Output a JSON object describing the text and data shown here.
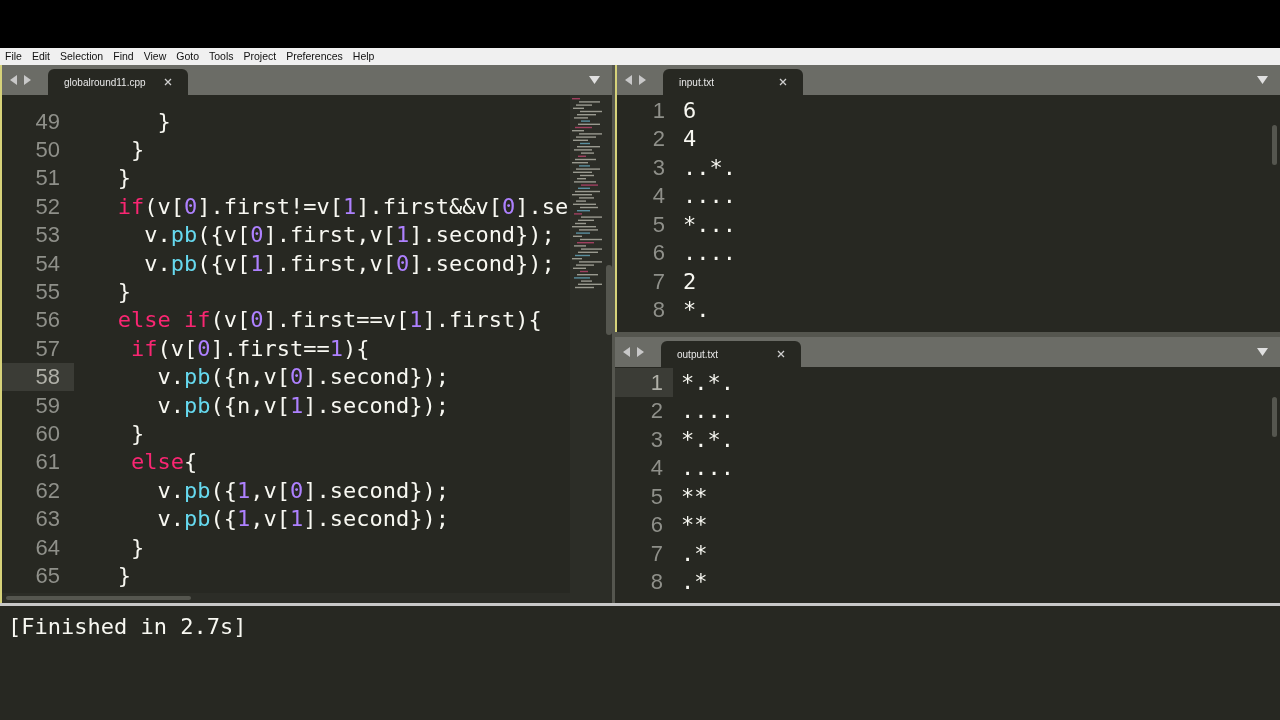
{
  "menu": [
    {
      "label": "File"
    },
    {
      "label": "Edit"
    },
    {
      "label": "Selection"
    },
    {
      "label": "Find"
    },
    {
      "label": "View"
    },
    {
      "label": "Goto"
    },
    {
      "label": "Tools"
    },
    {
      "label": "Project"
    },
    {
      "label": "Preferences"
    },
    {
      "label": "Help"
    }
  ],
  "left_pane": {
    "tab": {
      "label": "globalround11.cpp",
      "selected": true
    },
    "lines": [
      {
        "number": "49",
        "current": false,
        "segments": [
          {
            "kind": "plain",
            "text": "      }"
          }
        ]
      },
      {
        "number": "50",
        "current": false,
        "segments": [
          {
            "kind": "plain",
            "text": "    }"
          }
        ]
      },
      {
        "number": "51",
        "current": false,
        "segments": [
          {
            "kind": "plain",
            "text": "   }"
          }
        ]
      },
      {
        "number": "52",
        "current": false,
        "segments": [
          {
            "kind": "keyword",
            "text": "   if"
          },
          {
            "kind": "plain",
            "text": "(v["
          },
          {
            "kind": "number",
            "text": "0"
          },
          {
            "kind": "plain",
            "text": "].first!=v["
          },
          {
            "kind": "number",
            "text": "1"
          },
          {
            "kind": "plain",
            "text": "].first&&v["
          },
          {
            "kind": "number",
            "text": "0"
          },
          {
            "kind": "plain",
            "text": "].se"
          }
        ]
      },
      {
        "number": "53",
        "current": false,
        "segments": [
          {
            "kind": "plain",
            "text": "     v."
          },
          {
            "kind": "builtin",
            "text": "pb"
          },
          {
            "kind": "plain",
            "text": "({v["
          },
          {
            "kind": "number",
            "text": "0"
          },
          {
            "kind": "plain",
            "text": "].first,v["
          },
          {
            "kind": "number",
            "text": "1"
          },
          {
            "kind": "plain",
            "text": "].second});"
          }
        ]
      },
      {
        "number": "54",
        "current": false,
        "segments": [
          {
            "kind": "plain",
            "text": "     v."
          },
          {
            "kind": "builtin",
            "text": "pb"
          },
          {
            "kind": "plain",
            "text": "({v["
          },
          {
            "kind": "number",
            "text": "1"
          },
          {
            "kind": "plain",
            "text": "].first,v["
          },
          {
            "kind": "number",
            "text": "0"
          },
          {
            "kind": "plain",
            "text": "].second});"
          }
        ]
      },
      {
        "number": "55",
        "current": false,
        "segments": [
          {
            "kind": "plain",
            "text": "   }"
          }
        ]
      },
      {
        "number": "56",
        "current": false,
        "segments": [
          {
            "kind": "keyword",
            "text": "   else"
          },
          {
            "kind": "keyword",
            "text": " if"
          },
          {
            "kind": "plain",
            "text": "(v["
          },
          {
            "kind": "number",
            "text": "0"
          },
          {
            "kind": "plain",
            "text": "].first==v["
          },
          {
            "kind": "number",
            "text": "1"
          },
          {
            "kind": "plain",
            "text": "].first){"
          }
        ]
      },
      {
        "number": "57",
        "current": false,
        "segments": [
          {
            "kind": "keyword",
            "text": "    if"
          },
          {
            "kind": "plain",
            "text": "(v["
          },
          {
            "kind": "number",
            "text": "0"
          },
          {
            "kind": "plain",
            "text": "].first=="
          },
          {
            "kind": "number",
            "text": "1"
          },
          {
            "kind": "plain",
            "text": "){"
          }
        ]
      },
      {
        "number": "58",
        "current": true,
        "segments": [
          {
            "kind": "plain",
            "text": "      v."
          },
          {
            "kind": "builtin",
            "text": "pb"
          },
          {
            "kind": "plain",
            "text": "({n,v["
          },
          {
            "kind": "number",
            "text": "0"
          },
          {
            "kind": "plain",
            "text": "].second});"
          }
        ]
      },
      {
        "number": "59",
        "current": false,
        "segments": [
          {
            "kind": "plain",
            "text": "      v."
          },
          {
            "kind": "builtin",
            "text": "pb"
          },
          {
            "kind": "plain",
            "text": "({n,v["
          },
          {
            "kind": "number",
            "text": "1"
          },
          {
            "kind": "plain",
            "text": "].second});"
          }
        ]
      },
      {
        "number": "60",
        "current": false,
        "segments": [
          {
            "kind": "plain",
            "text": "    }"
          }
        ]
      },
      {
        "number": "61",
        "current": false,
        "segments": [
          {
            "kind": "keyword",
            "text": "    else"
          },
          {
            "kind": "plain",
            "text": "{"
          }
        ]
      },
      {
        "number": "62",
        "current": false,
        "segments": [
          {
            "kind": "plain",
            "text": "      v."
          },
          {
            "kind": "builtin",
            "text": "pb"
          },
          {
            "kind": "plain",
            "text": "({"
          },
          {
            "kind": "number",
            "text": "1"
          },
          {
            "kind": "plain",
            "text": ",v["
          },
          {
            "kind": "number",
            "text": "0"
          },
          {
            "kind": "plain",
            "text": "].second});"
          }
        ]
      },
      {
        "number": "63",
        "current": false,
        "segments": [
          {
            "kind": "plain",
            "text": "      v."
          },
          {
            "kind": "builtin",
            "text": "pb"
          },
          {
            "kind": "plain",
            "text": "({"
          },
          {
            "kind": "number",
            "text": "1"
          },
          {
            "kind": "plain",
            "text": ",v["
          },
          {
            "kind": "number",
            "text": "1"
          },
          {
            "kind": "plain",
            "text": "].second});"
          }
        ]
      },
      {
        "number": "64",
        "current": false,
        "segments": [
          {
            "kind": "plain",
            "text": "    }"
          }
        ]
      },
      {
        "number": "65",
        "current": false,
        "segments": [
          {
            "kind": "plain",
            "text": "   }"
          }
        ]
      }
    ]
  },
  "input_pane": {
    "tab": {
      "label": "input.txt",
      "selected": true
    },
    "lines": [
      {
        "number": "1",
        "current": false,
        "text": "6"
      },
      {
        "number": "2",
        "current": false,
        "text": "4"
      },
      {
        "number": "3",
        "current": false,
        "text": "..*."
      },
      {
        "number": "4",
        "current": false,
        "text": "...."
      },
      {
        "number": "5",
        "current": false,
        "text": "*..."
      },
      {
        "number": "6",
        "current": false,
        "text": "...."
      },
      {
        "number": "7",
        "current": false,
        "text": "2"
      },
      {
        "number": "8",
        "current": false,
        "text": "*."
      }
    ]
  },
  "output_pane": {
    "tab": {
      "label": "output.txt",
      "selected": true
    },
    "lines": [
      {
        "number": "1",
        "current": true,
        "text": "*.*."
      },
      {
        "number": "2",
        "current": false,
        "text": "...."
      },
      {
        "number": "3",
        "current": false,
        "text": "*.*."
      },
      {
        "number": "4",
        "current": false,
        "text": "...."
      },
      {
        "number": "5",
        "current": false,
        "text": "**"
      },
      {
        "number": "6",
        "current": false,
        "text": "**"
      },
      {
        "number": "7",
        "current": false,
        "text": ".*"
      },
      {
        "number": "8",
        "current": false,
        "text": ".*"
      }
    ]
  },
  "build_output": {
    "text": "[Finished in 2.7s]"
  }
}
